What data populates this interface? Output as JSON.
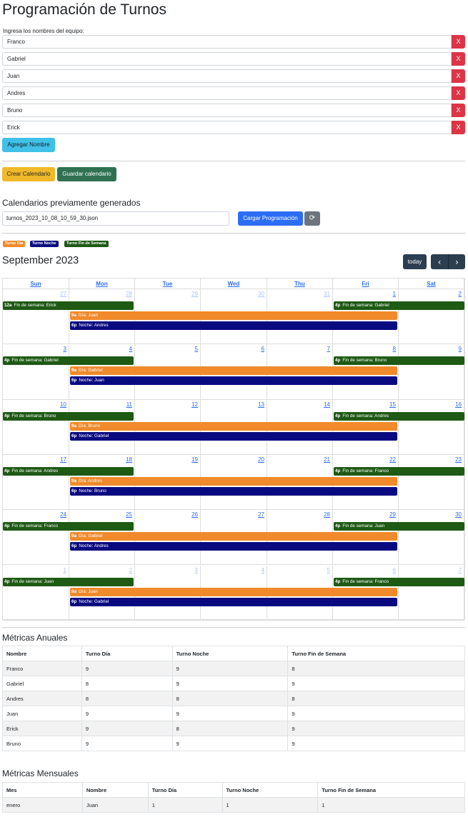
{
  "page": {
    "title": "Programación de Turnos"
  },
  "team": {
    "label": "Ingresa los nombres del equipo:",
    "members": [
      "Franco",
      "Gabriel",
      "Juan",
      "Andres",
      "Bruno",
      "Erick"
    ],
    "delete_label": "X",
    "add_label": "Agregar Nombre"
  },
  "actions": {
    "create_label": "Crear Calendario",
    "save_label": "Guardar calendario"
  },
  "previous": {
    "title": "Calendarios previamente generados",
    "selected_file": "turnos_2023_10_08_10_59_30.json",
    "load_label": "Cargar Programación",
    "refresh_icon": "⟳"
  },
  "legend": {
    "day": {
      "label": "Turno Día",
      "color": "#f08a2b"
    },
    "night": {
      "label": "Turno Noche",
      "color": "#0a0a80"
    },
    "weekend": {
      "label": "Turno Fin de Semana",
      "color": "#1e5a14"
    }
  },
  "calendar": {
    "title": "September 2023",
    "today_label": "today",
    "prev_icon": "‹",
    "next_icon": "›",
    "weekdays": [
      "Sun",
      "Mon",
      "Tue",
      "Wed",
      "Thu",
      "Fri",
      "Sat"
    ],
    "weeks": [
      {
        "days": [
          "27",
          "28",
          "29",
          "30",
          "31",
          "1",
          "2"
        ],
        "other": [
          true,
          true,
          true,
          true,
          true,
          false,
          false
        ],
        "weekend_start": {
          "time": "12a",
          "text": "Fin de semana: Erick"
        },
        "weekend_end": {
          "time": "4p",
          "text": "Fin de semana: Gabriel"
        },
        "day_shift": {
          "time": "9a",
          "text": "Día: Juan"
        },
        "night_shift": {
          "time": "6p",
          "text": "Noche: Andres"
        }
      },
      {
        "days": [
          "3",
          "4",
          "5",
          "6",
          "7",
          "8",
          "9"
        ],
        "other": [
          false,
          false,
          false,
          false,
          false,
          false,
          false
        ],
        "weekend_start": {
          "time": "4p",
          "text": "Fin de semana: Gabriel"
        },
        "weekend_end": {
          "time": "4p",
          "text": "Fin de semana: Bruno"
        },
        "day_shift": {
          "time": "9a",
          "text": "Día: Gabriel"
        },
        "night_shift": {
          "time": "6p",
          "text": "Noche: Juan"
        }
      },
      {
        "days": [
          "10",
          "11",
          "12",
          "13",
          "14",
          "15",
          "16"
        ],
        "other": [
          false,
          false,
          false,
          false,
          false,
          false,
          false
        ],
        "weekend_start": {
          "time": "4p",
          "text": "Fin de semana: Bruno"
        },
        "weekend_end": {
          "time": "4p",
          "text": "Fin de semana: Andres"
        },
        "day_shift": {
          "time": "9a",
          "text": "Día: Bruno"
        },
        "night_shift": {
          "time": "6p",
          "text": "Noche: Gabriel"
        }
      },
      {
        "days": [
          "17",
          "18",
          "19",
          "20",
          "21",
          "22",
          "23"
        ],
        "other": [
          false,
          false,
          false,
          false,
          false,
          false,
          false
        ],
        "weekend_start": {
          "time": "4p",
          "text": "Fin de semana: Andres"
        },
        "weekend_end": {
          "time": "4p",
          "text": "Fin de semana: Franco"
        },
        "day_shift": {
          "time": "9a",
          "text": "Día: Andres"
        },
        "night_shift": {
          "time": "6p",
          "text": "Noche: Bruno"
        }
      },
      {
        "days": [
          "24",
          "25",
          "26",
          "27",
          "28",
          "29",
          "30"
        ],
        "other": [
          false,
          false,
          false,
          false,
          false,
          false,
          false
        ],
        "weekend_start": {
          "time": "4p",
          "text": "Fin de semana: Franco"
        },
        "weekend_end": {
          "time": "4p",
          "text": "Fin de semana: Juan"
        },
        "day_shift": {
          "time": "9a",
          "text": "Día: Gabriel"
        },
        "night_shift": {
          "time": "6p",
          "text": "Noche: Andres"
        }
      },
      {
        "days": [
          "1",
          "2",
          "3",
          "4",
          "5",
          "6",
          "7"
        ],
        "other": [
          true,
          true,
          true,
          true,
          true,
          true,
          true
        ],
        "weekend_start": {
          "time": "4p",
          "text": "Fin de semana: Juan"
        },
        "weekend_end": {
          "time": "4p",
          "text": "Fin de semana: Franco"
        },
        "day_shift": {
          "time": "9a",
          "text": "Día: Juan"
        },
        "night_shift": {
          "time": "6p",
          "text": "Noche: Gabriel"
        }
      }
    ]
  },
  "annual": {
    "title": "Métricas Anuales",
    "headers": [
      "Nombre",
      "Turno Día",
      "Turno Noche",
      "Turno Fin de Semana"
    ],
    "rows": [
      [
        "Franco",
        "9",
        "9",
        "8"
      ],
      [
        "Gabriel",
        "8",
        "9",
        "9"
      ],
      [
        "Andres",
        "8",
        "8",
        "8"
      ],
      [
        "Juan",
        "9",
        "9",
        "9"
      ],
      [
        "Erick",
        "9",
        "8",
        "9"
      ],
      [
        "Bruno",
        "9",
        "9",
        "9"
      ]
    ]
  },
  "monthly": {
    "title": "Métricas Mensuales",
    "headers": [
      "Mes",
      "Nombre",
      "Turno Día",
      "Turno Noche",
      "Turno Fin de Semana"
    ],
    "rows": [
      [
        "enero",
        "Juan",
        "1",
        "1",
        "1"
      ]
    ]
  }
}
